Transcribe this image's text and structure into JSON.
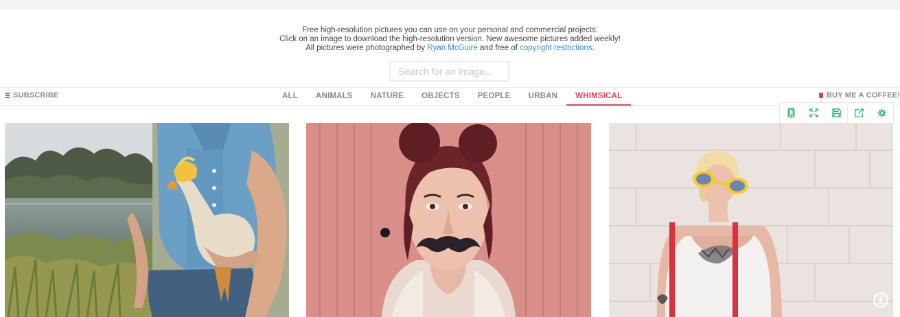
{
  "intro": {
    "line1": "Free high-resolution pictures you can use on your personal and commercial projects.",
    "line2": "Click on an image to download the high-resolution version. New awesome pictures added weekly!",
    "line3_pre": "All pictures were photographed by ",
    "author": "Ryan McGuire",
    "line3_mid": " and free of ",
    "license_link": "copyright restrictions",
    "line3_post": "."
  },
  "search": {
    "placeholder": "Search for an image..."
  },
  "nav": {
    "left_link": "SUBSCRIBE",
    "right_link": "BUY ME A COFFEE!",
    "tabs": [
      {
        "label": "ALL"
      },
      {
        "label": "ANIMALS"
      },
      {
        "label": "NATURE"
      },
      {
        "label": "OBJECTS"
      },
      {
        "label": "PEOPLE"
      },
      {
        "label": "URBAN"
      },
      {
        "label": "WHIMSICAL",
        "active": true
      }
    ]
  },
  "toolbar": {
    "icons": [
      "tablet-icon",
      "fullscreen-icon",
      "save-icon",
      "share-icon",
      "settings-icon"
    ],
    "color": "#2db567"
  },
  "photos": [
    {
      "subject": "man-holding-goose-with-yellow-wig"
    },
    {
      "subject": "woman-with-fake-mustache"
    },
    {
      "subject": "woman-with-yellow-sunglasses-tattoos"
    }
  ],
  "colors": {
    "accent": "#e0445a",
    "link": "#2a8fd6"
  }
}
